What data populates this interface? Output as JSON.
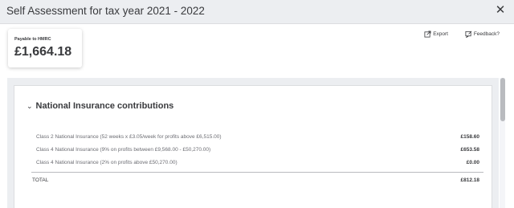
{
  "window": {
    "title": "Self Assessment for tax year 2021 - 2022"
  },
  "summary": {
    "label": "Payable to HMRC",
    "amount": "£1,664.18"
  },
  "actions": {
    "export_label": "Export",
    "feedback_label": "Feedback?"
  },
  "section": {
    "title": "National Insurance contributions",
    "rows": [
      {
        "label": "Class 2 National Insurance (52 weeks x £3.05/week for profits above £6,515.00)",
        "amount": "£158.60"
      },
      {
        "label": "Class 4 National Insurance (9% on profits between £9,568.00 - £50,270.00)",
        "amount": "£653.58"
      },
      {
        "label": "Class 4 National Insurance (2% on profits above £50,270.00)",
        "amount": "£0.00"
      }
    ],
    "total_label": "TOTAL",
    "total_amount": "£812.18"
  },
  "icons": {
    "close": "close-icon",
    "export": "export-icon",
    "feedback": "feedback-icon",
    "chevron": "chevron-down-icon"
  }
}
